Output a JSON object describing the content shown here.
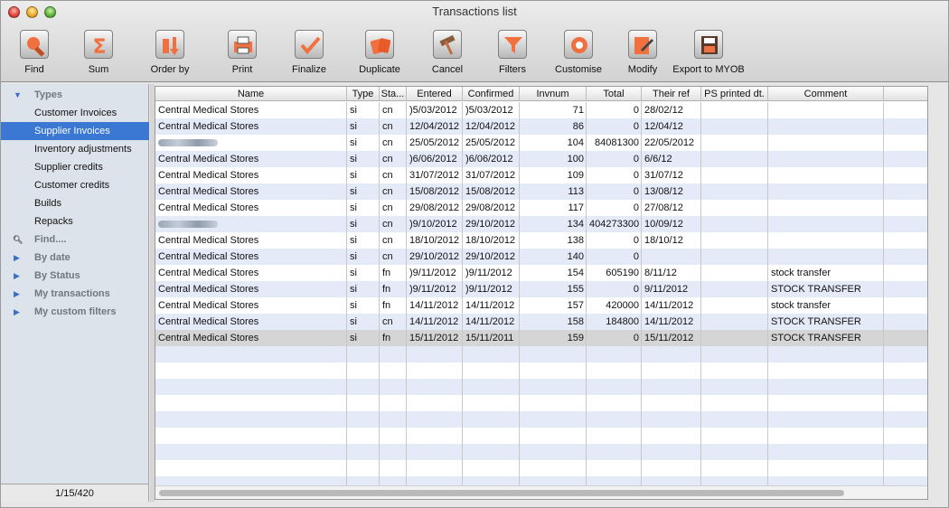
{
  "window": {
    "title": "Transactions list"
  },
  "toolbar": [
    {
      "label": "Find",
      "icon": "find-icon"
    },
    {
      "label": "Sum",
      "icon": "sum-icon"
    },
    {
      "label": "Order by",
      "icon": "order-by-icon"
    },
    {
      "label": "Print",
      "icon": "print-icon"
    },
    {
      "label": "Finalize",
      "icon": "finalize-icon"
    },
    {
      "label": "Duplicate",
      "icon": "duplicate-icon"
    },
    {
      "label": "Cancel",
      "icon": "cancel-icon"
    },
    {
      "label": "Filters",
      "icon": "filters-icon"
    },
    {
      "label": "Customise",
      "icon": "customise-icon"
    },
    {
      "label": "Modify",
      "icon": "modify-icon"
    },
    {
      "label": "Export to MYOB",
      "icon": "export-myob-icon"
    }
  ],
  "sidebar": {
    "types_header": "Types",
    "items": [
      {
        "label": "Customer Invoices"
      },
      {
        "label": "Supplier Invoices",
        "selected": true
      },
      {
        "label": "Inventory adjustments"
      },
      {
        "label": "Supplier credits"
      },
      {
        "label": "Customer credits"
      },
      {
        "label": "Builds"
      },
      {
        "label": "Repacks"
      }
    ],
    "find_label": "Find....",
    "groups": [
      {
        "label": "By date"
      },
      {
        "label": "By Status"
      },
      {
        "label": "My transactions"
      },
      {
        "label": "My custom filters"
      }
    ],
    "footer": "1/15/420"
  },
  "table": {
    "columns": [
      "Name",
      "Type",
      "Sta...",
      "Entered",
      "Confirmed",
      "Invnum",
      "Total",
      "Their ref",
      "PS printed dt.",
      "Comment"
    ],
    "rows": [
      {
        "name": "Central Medical Stores",
        "type": "si",
        "status": "cn",
        "entered": ")5/03/2012",
        "confirmed": ")5/03/2012",
        "invnum": "71",
        "total": "0",
        "their_ref": "28/02/12",
        "ps_printed": "",
        "comment": ""
      },
      {
        "name": "Central Medical Stores",
        "type": "si",
        "status": "cn",
        "entered": "12/04/2012",
        "confirmed": "12/04/2012",
        "invnum": "86",
        "total": "0",
        "their_ref": "12/04/12",
        "ps_printed": "",
        "comment": ""
      },
      {
        "name": "",
        "blurred": true,
        "type": "si",
        "status": "cn",
        "entered": "25/05/2012",
        "confirmed": "25/05/2012",
        "invnum": "104",
        "total": "84081300",
        "their_ref": "22/05/2012",
        "ps_printed": "",
        "comment": ""
      },
      {
        "name": "Central Medical Stores",
        "type": "si",
        "status": "cn",
        "entered": ")6/06/2012",
        "confirmed": ")6/06/2012",
        "invnum": "100",
        "total": "0",
        "their_ref": "6/6/12",
        "ps_printed": "",
        "comment": ""
      },
      {
        "name": "Central Medical Stores",
        "type": "si",
        "status": "cn",
        "entered": "31/07/2012",
        "confirmed": "31/07/2012",
        "invnum": "109",
        "total": "0",
        "their_ref": "31/07/12",
        "ps_printed": "",
        "comment": ""
      },
      {
        "name": "Central Medical Stores",
        "type": "si",
        "status": "cn",
        "entered": "15/08/2012",
        "confirmed": "15/08/2012",
        "invnum": "113",
        "total": "0",
        "their_ref": "13/08/12",
        "ps_printed": "",
        "comment": ""
      },
      {
        "name": "Central Medical Stores",
        "type": "si",
        "status": "cn",
        "entered": "29/08/2012",
        "confirmed": "29/08/2012",
        "invnum": "117",
        "total": "0",
        "their_ref": "27/08/12",
        "ps_printed": "",
        "comment": ""
      },
      {
        "name": "",
        "blurred": true,
        "type": "si",
        "status": "cn",
        "entered": ")9/10/2012",
        "confirmed": "29/10/2012",
        "invnum": "134",
        "total": "404273300",
        "their_ref": "10/09/12",
        "ps_printed": "",
        "comment": ""
      },
      {
        "name": "Central Medical Stores",
        "type": "si",
        "status": "cn",
        "entered": "18/10/2012",
        "confirmed": "18/10/2012",
        "invnum": "138",
        "total": "0",
        "their_ref": "18/10/12",
        "ps_printed": "",
        "comment": ""
      },
      {
        "name": "Central Medical Stores",
        "type": "si",
        "status": "cn",
        "entered": "29/10/2012",
        "confirmed": "29/10/2012",
        "invnum": "140",
        "total": "0",
        "their_ref": "",
        "ps_printed": "",
        "comment": ""
      },
      {
        "name": "Central Medical Stores",
        "type": "si",
        "status": "fn",
        "entered": ")9/11/2012",
        "confirmed": ")9/11/2012",
        "invnum": "154",
        "total": "605190",
        "their_ref": "8/11/12",
        "ps_printed": "",
        "comment": "stock transfer"
      },
      {
        "name": "Central Medical Stores",
        "type": "si",
        "status": "fn",
        "entered": ")9/11/2012",
        "confirmed": ")9/11/2012",
        "invnum": "155",
        "total": "0",
        "their_ref": "9/11/2012",
        "ps_printed": "",
        "comment": "STOCK TRANSFER"
      },
      {
        "name": "Central Medical Stores",
        "type": "si",
        "status": "fn",
        "entered": "14/11/2012",
        "confirmed": "14/11/2012",
        "invnum": "157",
        "total": "420000",
        "their_ref": "14/11/2012",
        "ps_printed": "",
        "comment": "stock transfer"
      },
      {
        "name": "Central Medical Stores",
        "type": "si",
        "status": "cn",
        "entered": "14/11/2012",
        "confirmed": "14/11/2012",
        "invnum": "158",
        "total": "184800",
        "their_ref": "14/11/2012",
        "ps_printed": "",
        "comment": "STOCK TRANSFER"
      },
      {
        "name": "Central Medical Stores",
        "type": "si",
        "status": "fn",
        "entered": "15/11/2012",
        "confirmed": "15/11/2011",
        "invnum": "159",
        "total": "0",
        "their_ref": "15/11/2012",
        "ps_printed": "",
        "comment": "STOCK TRANSFER",
        "selected": true
      }
    ]
  },
  "colors": {
    "accent": "#f07040",
    "selection": "#3a78d4",
    "row_stripe": "#e4eaf8"
  }
}
